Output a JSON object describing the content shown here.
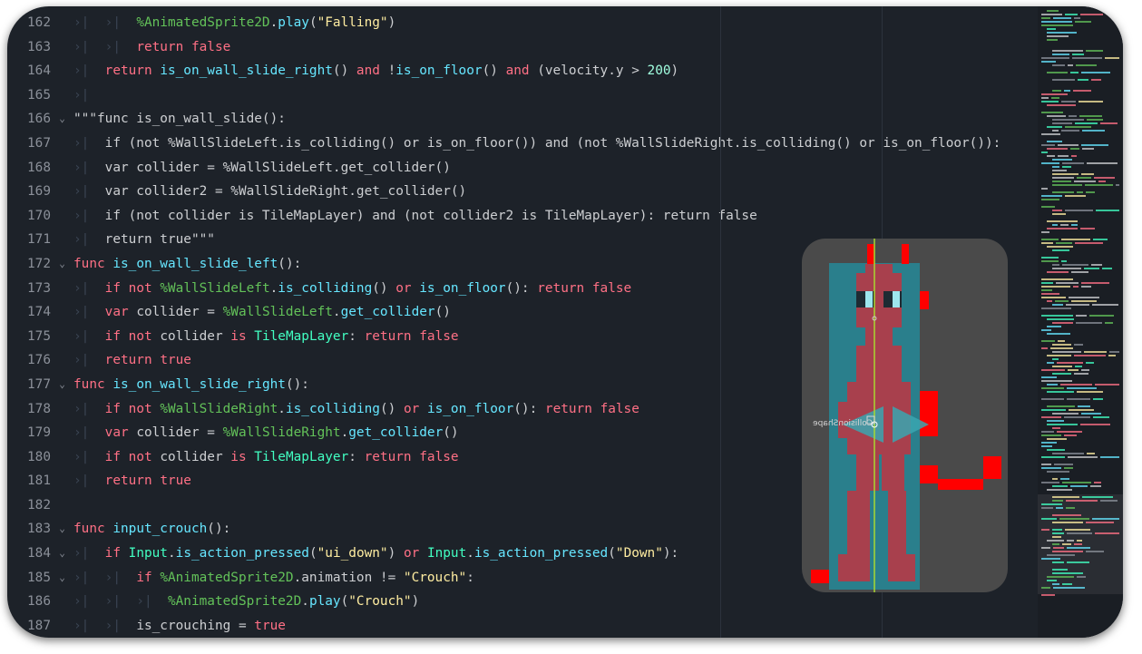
{
  "editor": {
    "lines": [
      {
        "num": "162",
        "tabs": "›|  ›|  ",
        "tokens": [
          {
            "c": "nd",
            "t": "%AnimatedSprite2D"
          },
          {
            "c": "id",
            "t": "."
          },
          {
            "c": "fn",
            "t": "play"
          },
          {
            "c": "id",
            "t": "("
          },
          {
            "c": "str",
            "t": "\"Falling\""
          },
          {
            "c": "id",
            "t": ")"
          }
        ]
      },
      {
        "num": "163",
        "tabs": "›|  ›|  ",
        "tokens": [
          {
            "c": "kw",
            "t": "return"
          },
          {
            "c": "id",
            "t": " "
          },
          {
            "c": "kw",
            "t": "false"
          }
        ]
      },
      {
        "num": "164",
        "tabs": "›|  ",
        "tokens": [
          {
            "c": "kw",
            "t": "return"
          },
          {
            "c": "id",
            "t": " "
          },
          {
            "c": "fn",
            "t": "is_on_wall_slide_right"
          },
          {
            "c": "id",
            "t": "() "
          },
          {
            "c": "kw",
            "t": "and"
          },
          {
            "c": "id",
            "t": " !"
          },
          {
            "c": "fn",
            "t": "is_on_floor"
          },
          {
            "c": "id",
            "t": "() "
          },
          {
            "c": "kw",
            "t": "and"
          },
          {
            "c": "id",
            "t": " (velocity.y > "
          },
          {
            "c": "num",
            "t": "200"
          },
          {
            "c": "id",
            "t": ")"
          }
        ]
      },
      {
        "num": "165",
        "tabs": "›|",
        "tokens": []
      },
      {
        "num": "166",
        "fold": "⌄",
        "tabs": "",
        "tokens": [
          {
            "c": "cm",
            "t": "\"\"\"func is_on_wall_slide():"
          }
        ]
      },
      {
        "num": "167",
        "tabs": "›|  ",
        "tokens": [
          {
            "c": "cm",
            "t": "if (not %WallSlideLeft.is_colliding() or is_on_floor()) and (not %WallSlideRight.is_colliding() or is_on_floor()):"
          }
        ]
      },
      {
        "num": "168",
        "tabs": "›|  ",
        "tokens": [
          {
            "c": "cm",
            "t": "var collider = %WallSlideLeft.get_collider()"
          }
        ]
      },
      {
        "num": "169",
        "tabs": "›|  ",
        "tokens": [
          {
            "c": "cm",
            "t": "var collider2 = %WallSlideRight.get_collider()"
          }
        ]
      },
      {
        "num": "170",
        "tabs": "›|  ",
        "tokens": [
          {
            "c": "cm",
            "t": "if (not collider is TileMapLayer) and (not collider2 is TileMapLayer): return false"
          }
        ]
      },
      {
        "num": "171",
        "tabs": "›|  ",
        "tokens": [
          {
            "c": "cm",
            "t": "return true\"\"\""
          }
        ]
      },
      {
        "num": "172",
        "fold": "⌄",
        "tabs": "",
        "tokens": [
          {
            "c": "kw",
            "t": "func"
          },
          {
            "c": "id",
            "t": " "
          },
          {
            "c": "fn",
            "t": "is_on_wall_slide_left"
          },
          {
            "c": "id",
            "t": "():"
          }
        ]
      },
      {
        "num": "173",
        "tabs": "›|  ",
        "tokens": [
          {
            "c": "kw",
            "t": "if"
          },
          {
            "c": "id",
            "t": " "
          },
          {
            "c": "kw",
            "t": "not"
          },
          {
            "c": "id",
            "t": " "
          },
          {
            "c": "nd",
            "t": "%WallSlideLeft"
          },
          {
            "c": "id",
            "t": "."
          },
          {
            "c": "fn",
            "t": "is_colliding"
          },
          {
            "c": "id",
            "t": "() "
          },
          {
            "c": "kw",
            "t": "or"
          },
          {
            "c": "id",
            "t": " "
          },
          {
            "c": "fn",
            "t": "is_on_floor"
          },
          {
            "c": "id",
            "t": "(): "
          },
          {
            "c": "kw",
            "t": "return"
          },
          {
            "c": "id",
            "t": " "
          },
          {
            "c": "kw",
            "t": "false"
          }
        ]
      },
      {
        "num": "174",
        "tabs": "›|  ",
        "tokens": [
          {
            "c": "kw",
            "t": "var"
          },
          {
            "c": "id",
            "t": " collider = "
          },
          {
            "c": "nd",
            "t": "%WallSlideLeft"
          },
          {
            "c": "id",
            "t": "."
          },
          {
            "c": "fn",
            "t": "get_collider"
          },
          {
            "c": "id",
            "t": "()"
          }
        ]
      },
      {
        "num": "175",
        "tabs": "›|  ",
        "tokens": [
          {
            "c": "kw",
            "t": "if"
          },
          {
            "c": "id",
            "t": " "
          },
          {
            "c": "kw",
            "t": "not"
          },
          {
            "c": "id",
            "t": " collider "
          },
          {
            "c": "kw",
            "t": "is"
          },
          {
            "c": "id",
            "t": " "
          },
          {
            "c": "cls",
            "t": "TileMapLayer"
          },
          {
            "c": "id",
            "t": ": "
          },
          {
            "c": "kw",
            "t": "return"
          },
          {
            "c": "id",
            "t": " "
          },
          {
            "c": "kw",
            "t": "false"
          }
        ]
      },
      {
        "num": "176",
        "tabs": "›|  ",
        "tokens": [
          {
            "c": "kw",
            "t": "return"
          },
          {
            "c": "id",
            "t": " "
          },
          {
            "c": "kw",
            "t": "true"
          }
        ]
      },
      {
        "num": "177",
        "fold": "⌄",
        "tabs": "",
        "tokens": [
          {
            "c": "kw",
            "t": "func"
          },
          {
            "c": "id",
            "t": " "
          },
          {
            "c": "fn",
            "t": "is_on_wall_slide_right"
          },
          {
            "c": "id",
            "t": "():"
          }
        ]
      },
      {
        "num": "178",
        "tabs": "›|  ",
        "tokens": [
          {
            "c": "kw",
            "t": "if"
          },
          {
            "c": "id",
            "t": " "
          },
          {
            "c": "kw",
            "t": "not"
          },
          {
            "c": "id",
            "t": " "
          },
          {
            "c": "nd",
            "t": "%WallSlideRight"
          },
          {
            "c": "id",
            "t": "."
          },
          {
            "c": "fn",
            "t": "is_colliding"
          },
          {
            "c": "id",
            "t": "() "
          },
          {
            "c": "kw",
            "t": "or"
          },
          {
            "c": "id",
            "t": " "
          },
          {
            "c": "fn",
            "t": "is_on_floor"
          },
          {
            "c": "id",
            "t": "(): "
          },
          {
            "c": "kw",
            "t": "return"
          },
          {
            "c": "id",
            "t": " "
          },
          {
            "c": "kw",
            "t": "false"
          }
        ]
      },
      {
        "num": "179",
        "tabs": "›|  ",
        "tokens": [
          {
            "c": "kw",
            "t": "var"
          },
          {
            "c": "id",
            "t": " collider = "
          },
          {
            "c": "nd",
            "t": "%WallSlideRight"
          },
          {
            "c": "id",
            "t": "."
          },
          {
            "c": "fn",
            "t": "get_collider"
          },
          {
            "c": "id",
            "t": "()"
          }
        ]
      },
      {
        "num": "180",
        "tabs": "›|  ",
        "tokens": [
          {
            "c": "kw",
            "t": "if"
          },
          {
            "c": "id",
            "t": " "
          },
          {
            "c": "kw",
            "t": "not"
          },
          {
            "c": "id",
            "t": " collider "
          },
          {
            "c": "kw",
            "t": "is"
          },
          {
            "c": "id",
            "t": " "
          },
          {
            "c": "cls",
            "t": "TileMapLayer"
          },
          {
            "c": "id",
            "t": ": "
          },
          {
            "c": "kw",
            "t": "return"
          },
          {
            "c": "id",
            "t": " "
          },
          {
            "c": "kw",
            "t": "false"
          }
        ]
      },
      {
        "num": "181",
        "tabs": "›|  ",
        "tokens": [
          {
            "c": "kw",
            "t": "return"
          },
          {
            "c": "id",
            "t": " "
          },
          {
            "c": "kw",
            "t": "true"
          }
        ]
      },
      {
        "num": "182",
        "tabs": "",
        "tokens": []
      },
      {
        "num": "183",
        "fold": "⌄",
        "tabs": "",
        "tokens": [
          {
            "c": "kw",
            "t": "func"
          },
          {
            "c": "id",
            "t": " "
          },
          {
            "c": "fn",
            "t": "input_crouch"
          },
          {
            "c": "id",
            "t": "():"
          }
        ]
      },
      {
        "num": "184",
        "fold": "⌄",
        "tabs": "›|  ",
        "tokens": [
          {
            "c": "kw",
            "t": "if"
          },
          {
            "c": "id",
            "t": " "
          },
          {
            "c": "cls",
            "t": "Input"
          },
          {
            "c": "id",
            "t": "."
          },
          {
            "c": "fn",
            "t": "is_action_pressed"
          },
          {
            "c": "id",
            "t": "("
          },
          {
            "c": "str",
            "t": "\"ui_down\""
          },
          {
            "c": "id",
            "t": ") "
          },
          {
            "c": "kw",
            "t": "or"
          },
          {
            "c": "id",
            "t": " "
          },
          {
            "c": "cls",
            "t": "Input"
          },
          {
            "c": "id",
            "t": "."
          },
          {
            "c": "fn",
            "t": "is_action_pressed"
          },
          {
            "c": "id",
            "t": "("
          },
          {
            "c": "str",
            "t": "\"Down\""
          },
          {
            "c": "id",
            "t": "):"
          }
        ]
      },
      {
        "num": "185",
        "fold": "⌄",
        "tabs": "›|  ›|  ",
        "tokens": [
          {
            "c": "kw",
            "t": "if"
          },
          {
            "c": "id",
            "t": " "
          },
          {
            "c": "nd",
            "t": "%AnimatedSprite2D"
          },
          {
            "c": "id",
            "t": ".animation != "
          },
          {
            "c": "str",
            "t": "\"Crouch\""
          },
          {
            "c": "id",
            "t": ":"
          }
        ]
      },
      {
        "num": "186",
        "tabs": "›|  ›|  ›|  ",
        "tokens": [
          {
            "c": "nd",
            "t": "%AnimatedSprite2D"
          },
          {
            "c": "id",
            "t": "."
          },
          {
            "c": "fn",
            "t": "play"
          },
          {
            "c": "id",
            "t": "("
          },
          {
            "c": "str",
            "t": "\"Crouch\""
          },
          {
            "c": "id",
            "t": ")"
          }
        ]
      },
      {
        "num": "187",
        "tabs": "›|  ›|  ",
        "tokens": [
          {
            "c": "id",
            "t": "is_crouching = "
          },
          {
            "c": "kw",
            "t": "true"
          }
        ]
      }
    ]
  },
  "sprite_preview": {
    "collision_label": "CollisionShape"
  }
}
